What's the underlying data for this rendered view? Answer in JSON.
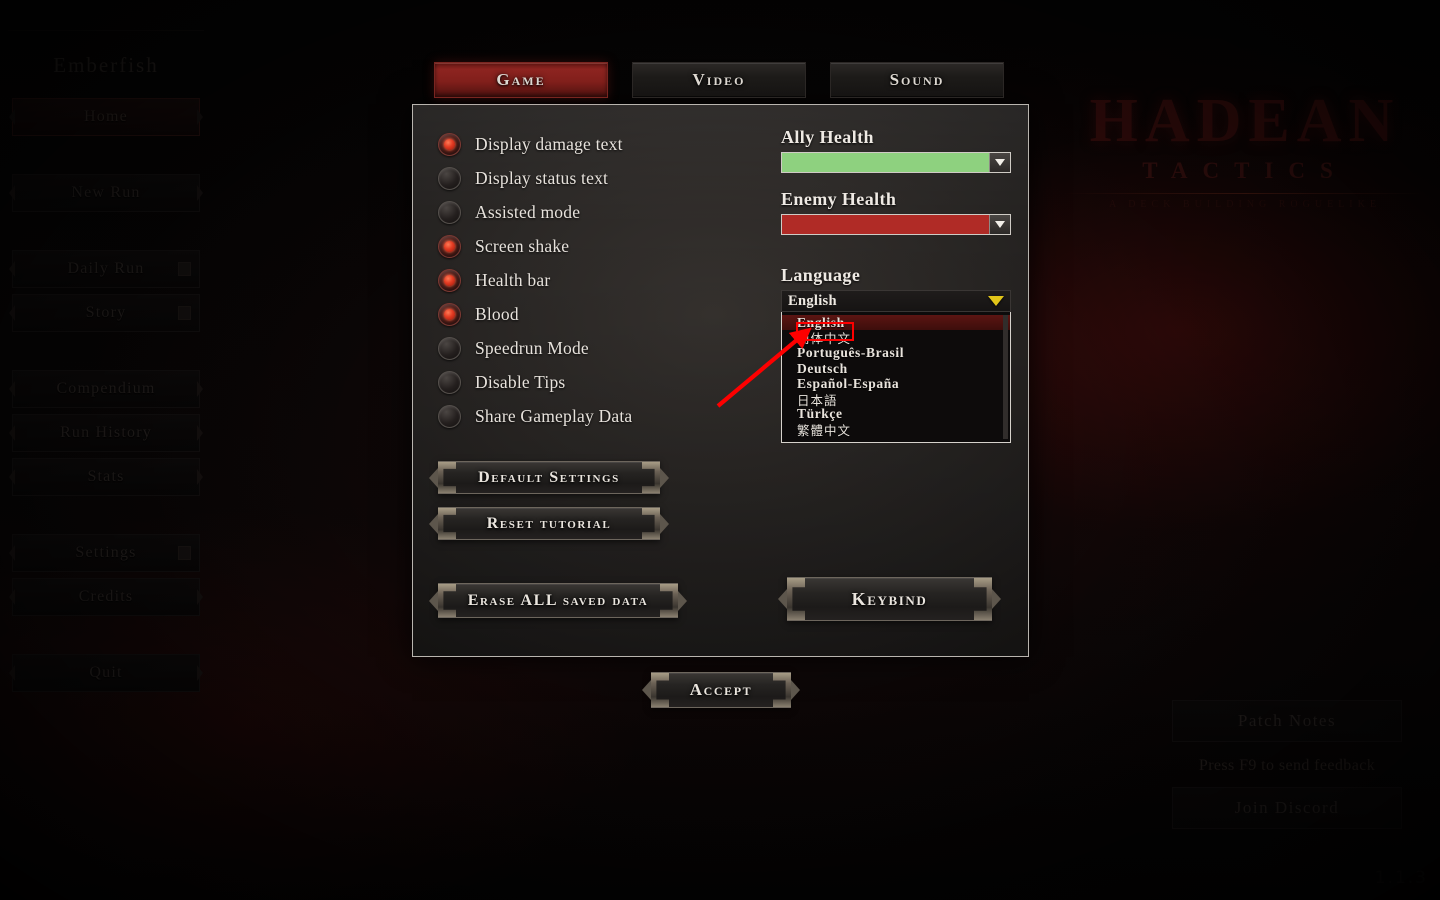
{
  "app": {
    "game_title_main": "HADEAN",
    "game_title_sub": "TACTICS",
    "game_title_tagline": "A DECK BUILDING ROGUELIKE",
    "watermark": "1.1.3"
  },
  "sidebar": {
    "brand": "Emberfish",
    "items": [
      {
        "label": "Home",
        "active": true
      },
      {
        "label": "New Run",
        "active": false
      },
      {
        "label": "Daily Run",
        "active": false
      },
      {
        "label": "Story",
        "active": false
      },
      {
        "label": "Compendium",
        "active": false
      },
      {
        "label": "Run History",
        "active": false
      },
      {
        "label": "Stats",
        "active": false
      },
      {
        "label": "Settings",
        "active": false
      },
      {
        "label": "Credits",
        "active": false
      },
      {
        "label": "Quit",
        "active": false
      }
    ]
  },
  "right_panel": {
    "patch_notes": "Patch Notes",
    "feedback_note": "Press F9 to send feedback",
    "join_discord": "Join Discord"
  },
  "settings": {
    "tabs": [
      {
        "label": "Game",
        "active": true
      },
      {
        "label": "Video",
        "active": false
      },
      {
        "label": "Sound",
        "active": false
      }
    ],
    "toggles": [
      {
        "label": "Display damage text",
        "on": true
      },
      {
        "label": "Display status text",
        "on": false
      },
      {
        "label": "Assisted mode",
        "on": false
      },
      {
        "label": "Screen shake",
        "on": true
      },
      {
        "label": "Health bar",
        "on": true
      },
      {
        "label": "Blood",
        "on": true
      },
      {
        "label": "Speedrun Mode",
        "on": false
      },
      {
        "label": "Disable Tips",
        "on": false
      },
      {
        "label": "Share Gameplay Data",
        "on": false
      }
    ],
    "color_selects": [
      {
        "label": "Ally Health",
        "color": "#8ed17f"
      },
      {
        "label": "Enemy Health",
        "color": "#b02b26"
      }
    ],
    "language": {
      "label": "Language",
      "selected": "English",
      "expanded": true,
      "options": [
        {
          "label": "English",
          "selected": true,
          "cjk": false
        },
        {
          "label": "简体中文",
          "selected": false,
          "cjk": true,
          "highlighted": true
        },
        {
          "label": "Português-Brasil",
          "selected": false,
          "cjk": false
        },
        {
          "label": "Deutsch",
          "selected": false,
          "cjk": false
        },
        {
          "label": "Español-España",
          "selected": false,
          "cjk": false
        },
        {
          "label": "日本語",
          "selected": false,
          "cjk": true
        },
        {
          "label": "Türkçe",
          "selected": false,
          "cjk": false
        },
        {
          "label": "繁體中文",
          "selected": false,
          "cjk": true
        }
      ]
    },
    "buttons": {
      "default_settings": "Default Settings",
      "reset_tutorial": "Reset tutorial",
      "erase_data": "Erase ALL saved data",
      "keybind": "Keybind",
      "accept": "Accept"
    }
  },
  "colors": {
    "accent_red": "#8d2420",
    "ally_health": "#8ed17f",
    "enemy_health": "#b02b26",
    "annotation_red": "#fe0000",
    "dropdown_chevron": "#e2c519"
  }
}
